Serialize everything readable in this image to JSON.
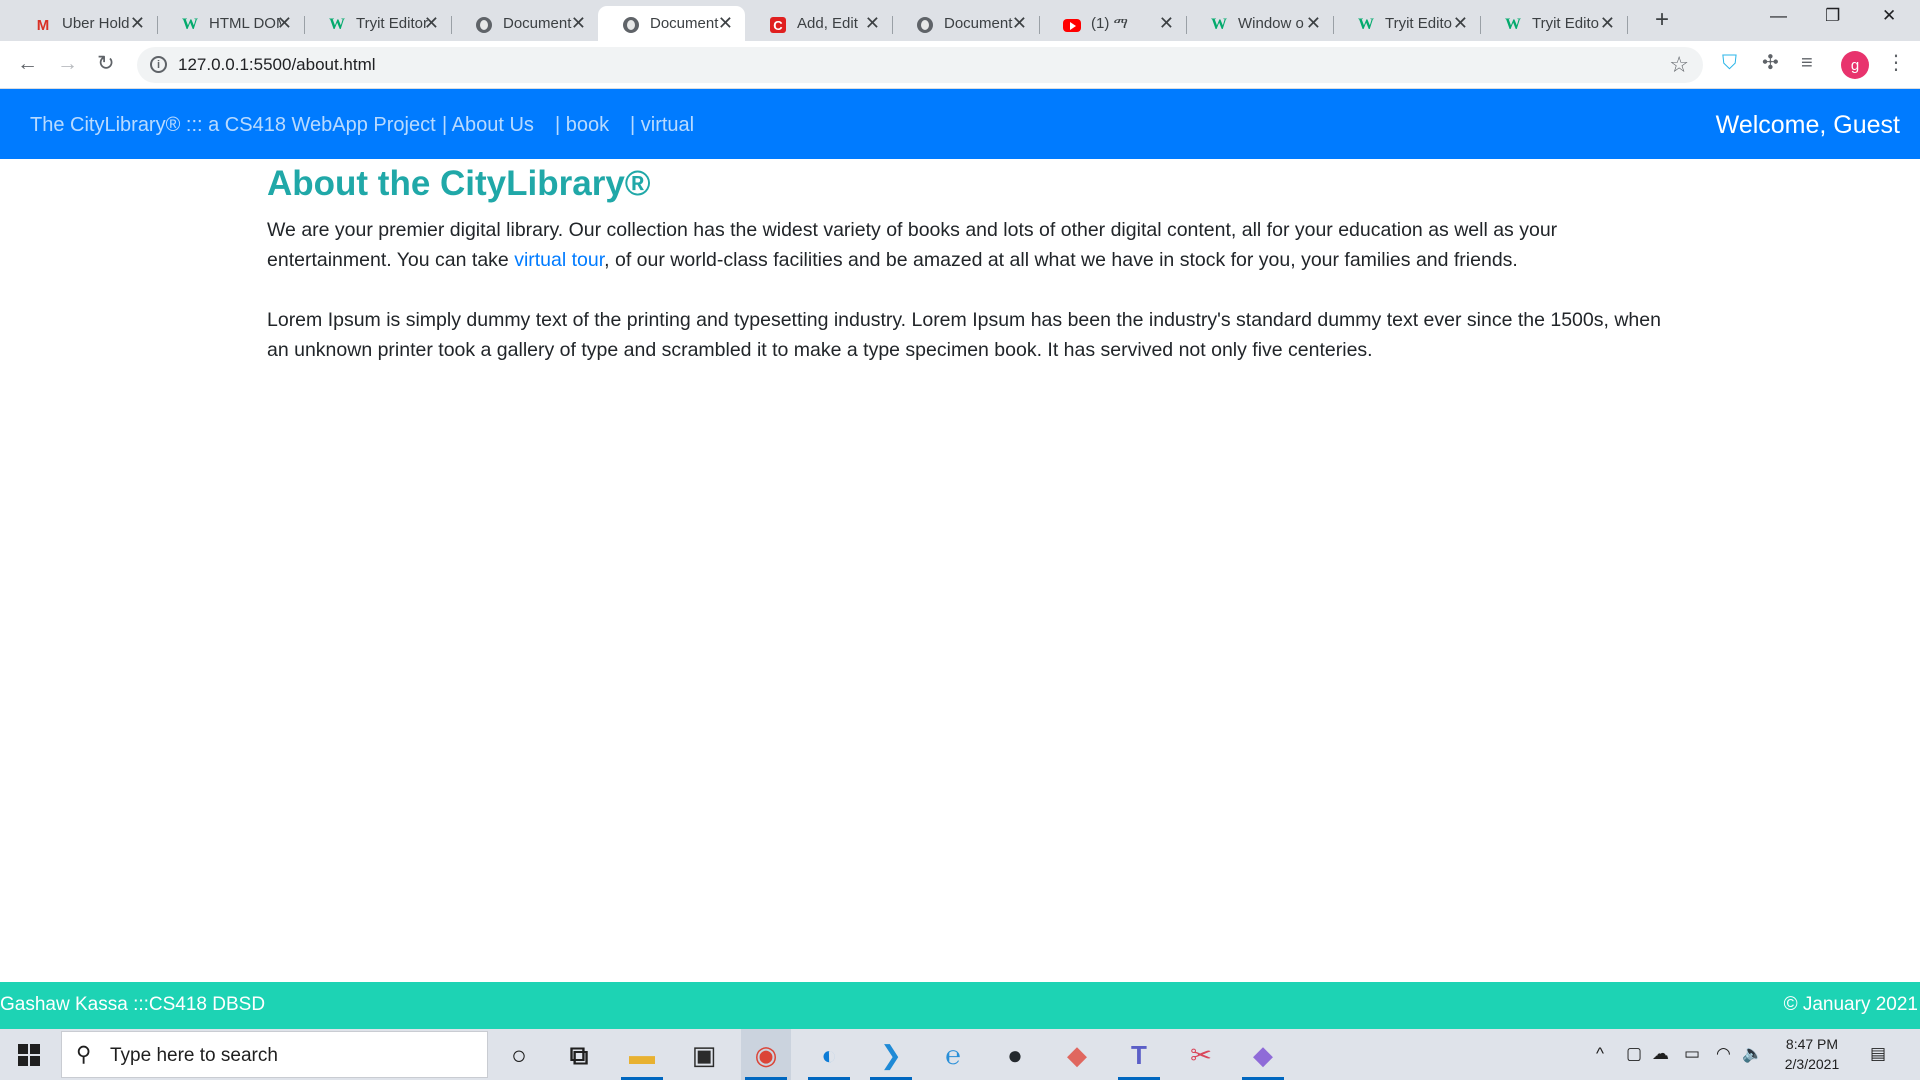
{
  "browser": {
    "tabs": [
      {
        "label": "Uber Hold",
        "icon": "gmail-icon",
        "active": false
      },
      {
        "label": "HTML DOM",
        "icon": "w3schools-icon",
        "active": false
      },
      {
        "label": "Tryit Editor",
        "icon": "w3schools-icon",
        "active": false
      },
      {
        "label": "Document",
        "icon": "globe-icon",
        "active": false
      },
      {
        "label": "Document",
        "icon": "globe-icon",
        "active": true
      },
      {
        "label": "Add, Edit",
        "icon": "c-icon",
        "active": false
      },
      {
        "label": "Document",
        "icon": "globe-icon",
        "active": false
      },
      {
        "label": "(1) ማ",
        "icon": "youtube-icon",
        "active": false
      },
      {
        "label": "Window o",
        "icon": "w3schools-icon",
        "active": false
      },
      {
        "label": "Tryit Edito",
        "icon": "w3schools-icon",
        "active": false
      },
      {
        "label": "Tryit Edito",
        "icon": "w3schools-icon",
        "active": false
      }
    ],
    "tab_close_glyph": "✕",
    "gmail_glyph": "M",
    "w3_glyph": "W",
    "c_glyph": "C",
    "new_tab_glyph": "+",
    "window_controls": {
      "minimize": "—",
      "restore": "❐",
      "close": "✕"
    },
    "nav": {
      "back": "←",
      "forward": "→",
      "reload": "↻"
    },
    "url": "127.0.0.1:5500/about.html",
    "info_glyph": "i",
    "star_glyph": "☆",
    "toolbar_icons": {
      "extension_a": "⛉",
      "puzzle": "✣",
      "media": "≡",
      "menu": "⋮"
    },
    "profile_initial": "g"
  },
  "site": {
    "brand": "The CityLibrary® ::: a CS418 WebApp Project",
    "nav_links": [
      "| About Us",
      "| book",
      "| virtual"
    ],
    "welcome": "Welcome, Guest",
    "page_title": "About the CityLibrary®",
    "para1_before": "We are your premier digital library. Our collection has the widest variety of books and lots of other digital content, all for your education as well as your entertainment. You can take ",
    "para1_link": "virtual tour",
    "para1_after": ", of our world-class facilities and be amazed at all what we have in stock for you, your families and friends.",
    "para2": "Lorem Ipsum is simply dummy text of the printing and typesetting industry. Lorem Ipsum has been the industry's standard dummy text ever since the 1500s, when an unknown printer took a gallery of type and scrambled it to make a type specimen book. It has servived not only five centeries.",
    "footer_left": "Gashaw Kassa :::CS418 DBSD",
    "footer_right": "© January 2021"
  },
  "taskbar": {
    "search_icon": "⚲",
    "search_placeholder": "Type here to search",
    "apps": [
      {
        "name": "cortana-icon",
        "glyph": "○",
        "color": "#1f1f1f",
        "running": false,
        "active": false
      },
      {
        "name": "task-view-icon",
        "glyph": "⧉",
        "color": "#1f1f1f",
        "running": false,
        "active": false
      },
      {
        "name": "file-explorer-icon",
        "glyph": "▬",
        "color": "#e8b130",
        "running": true,
        "active": false
      },
      {
        "name": "store-icon",
        "glyph": "▣",
        "color": "#2b2b2b",
        "running": false,
        "active": false
      },
      {
        "name": "chrome-icon",
        "glyph": "◉",
        "color": "#db4437",
        "running": true,
        "active": true
      },
      {
        "name": "edge-icon",
        "glyph": "◐",
        "color": "#0c7bd6",
        "running": true,
        "active": false
      },
      {
        "name": "vscode-icon",
        "glyph": "❯",
        "color": "#1f8ad6",
        "running": true,
        "active": false
      },
      {
        "name": "internet-explorer-icon",
        "glyph": "℮",
        "color": "#2a8fd8",
        "running": false,
        "active": false
      },
      {
        "name": "github-icon",
        "glyph": "●",
        "color": "#24292e",
        "running": false,
        "active": false
      },
      {
        "name": "git-kraken-icon",
        "glyph": "◆",
        "color": "#e0675f",
        "running": false,
        "active": false
      },
      {
        "name": "teams-icon",
        "glyph": "T",
        "color": "#5b5fc7",
        "running": true,
        "active": false
      },
      {
        "name": "snipping-tool-icon",
        "glyph": "✂",
        "color": "#d9475b",
        "running": false,
        "active": false
      },
      {
        "name": "git-client-icon",
        "glyph": "◆",
        "color": "#8f6bd8",
        "running": true,
        "active": false
      }
    ],
    "tray": {
      "chevron": "^",
      "meet": "▢",
      "cloud": "☁",
      "battery": "▭",
      "wifi": "◠",
      "volume": "🔈",
      "notifications": "▤"
    },
    "time": "8:47 PM",
    "date": "2/3/2021"
  }
}
